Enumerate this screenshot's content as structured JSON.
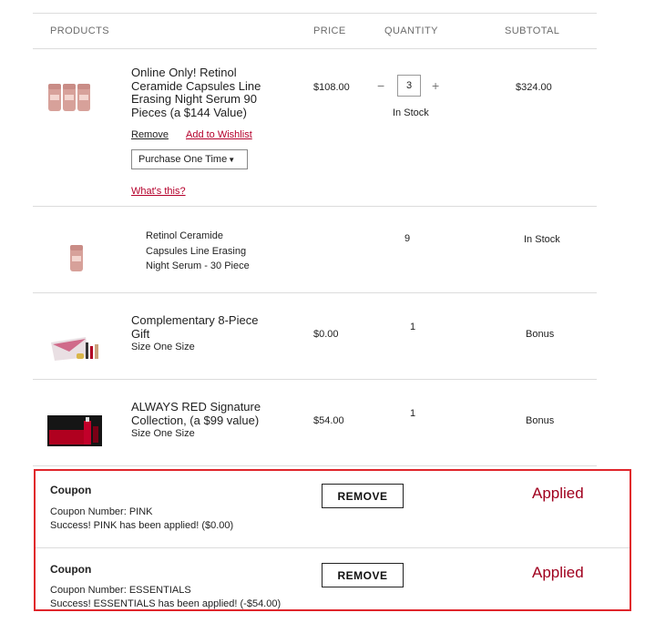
{
  "headers": {
    "products": "PRODUCTS",
    "price": "PRICE",
    "quantity": "QUANTITY",
    "subtotal": "SUBTOTAL"
  },
  "items": [
    {
      "name_lines": [
        "Online Only! Retinol",
        "Ceramide Capsules Line",
        "Erasing Night Serum 90",
        "Pieces (a $144 Value)"
      ],
      "price": "$108.00",
      "quantity": "3",
      "qty_minus": "−",
      "qty_plus": "+",
      "stock": "In Stock",
      "subtotal": "$324.00",
      "remove_label": "Remove",
      "wishlist_label": "Add to Wishlist",
      "purchase_option": "Purchase One Time",
      "whats_this": "What's this?"
    },
    {
      "name_lines": [
        "Retinol Ceramide",
        "Capsules Line Erasing",
        "Night Serum - 30 Piece"
      ],
      "quantity": "9",
      "subtotal": "In Stock"
    },
    {
      "name_lines": [
        "Complementary 8-Piece",
        "Gift"
      ],
      "size": "Size One Size",
      "price": "$0.00",
      "quantity": "1",
      "subtotal": "Bonus"
    },
    {
      "name_lines": [
        "ALWAYS RED Signature",
        "Collection, (a $99 value)"
      ],
      "size": "Size One Size",
      "price": "$54.00",
      "quantity": "1",
      "subtotal": "Bonus"
    }
  ],
  "coupons": [
    {
      "title": "Coupon",
      "number": "Coupon Number: PINK",
      "message": "Success! PINK has been applied! ($0.00)",
      "remove": "REMOVE",
      "status": "Applied"
    },
    {
      "title": "Coupon",
      "number": "Coupon Number: ESSENTIALS",
      "message": "Success! ESSENTIALS has been applied! (-$54.00)",
      "remove": "REMOVE",
      "status": "Applied"
    }
  ],
  "colors": {
    "accent_red": "#b5002b",
    "applied_red": "#a0001e",
    "highlight_frame": "#e0252b",
    "divider": "#dcdcdc"
  },
  "icons": {
    "dropdown": "caret-down-icon"
  }
}
